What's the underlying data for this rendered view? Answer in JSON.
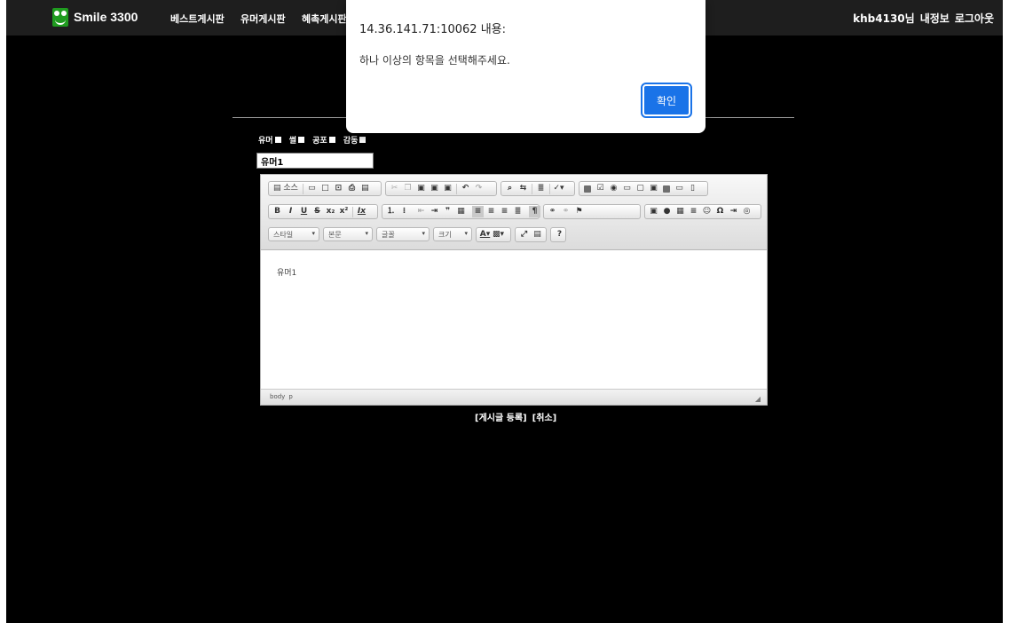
{
  "nav": {
    "logo_text": "Smile 3300",
    "items": [
      "베스트게시판",
      "유머게시판",
      "혜촉게시판"
    ],
    "user_name": "khb4130님",
    "profile": "내정보",
    "logout": "로그아웃"
  },
  "form": {
    "categories": [
      "유머",
      "썰",
      "공포",
      "감동"
    ],
    "title_value": "유머1"
  },
  "editor": {
    "toolbar_row1": [
      "소스"
    ],
    "toolbar_row2": [
      "B",
      "I",
      "U",
      "S",
      "x₂",
      "x²",
      "Ix"
    ],
    "combos": {
      "style": "스타일",
      "format": "본문",
      "font": "글꼴",
      "size": "크기"
    },
    "content": "유머1",
    "status_path": [
      "body",
      "p"
    ]
  },
  "actions": {
    "submit": "[게시글 등록]",
    "cancel": "[취소]"
  },
  "dialog": {
    "title": "14.36.141.71:10062 내용:",
    "message": "하나 이상의 항목을 선택해주세요.",
    "ok": "확인",
    "ok_color": "#1a73e8"
  }
}
